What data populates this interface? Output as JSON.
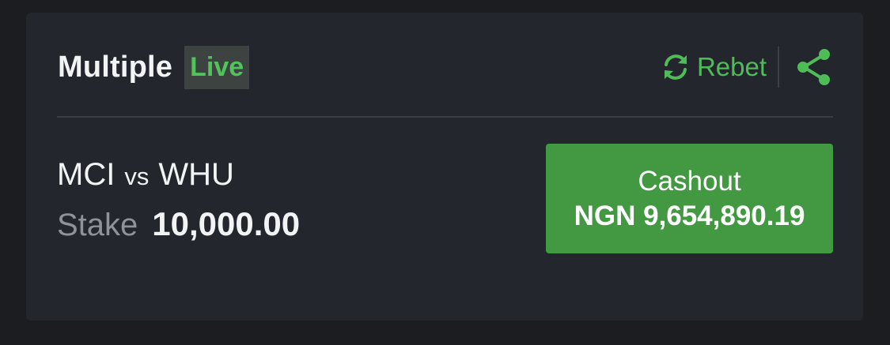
{
  "bet": {
    "type_label": "Multiple",
    "live_label": "Live",
    "rebet_label": "Rebet",
    "home_team": "MCI",
    "vs_label": "vs",
    "away_team": "WHU",
    "stake_label": "Stake",
    "stake_value": "10,000.00",
    "cashout_label": "Cashout",
    "cashout_amount": "NGN 9,654,890.19"
  },
  "icons": {
    "rebet": "refresh-icon",
    "share": "share-icon"
  },
  "colors": {
    "background": "#1c1d21",
    "card": "#23262c",
    "accent_green": "#4fbd57",
    "cashout_button": "#439842",
    "text_primary": "#f2f3f5",
    "text_muted": "#8e939b"
  }
}
